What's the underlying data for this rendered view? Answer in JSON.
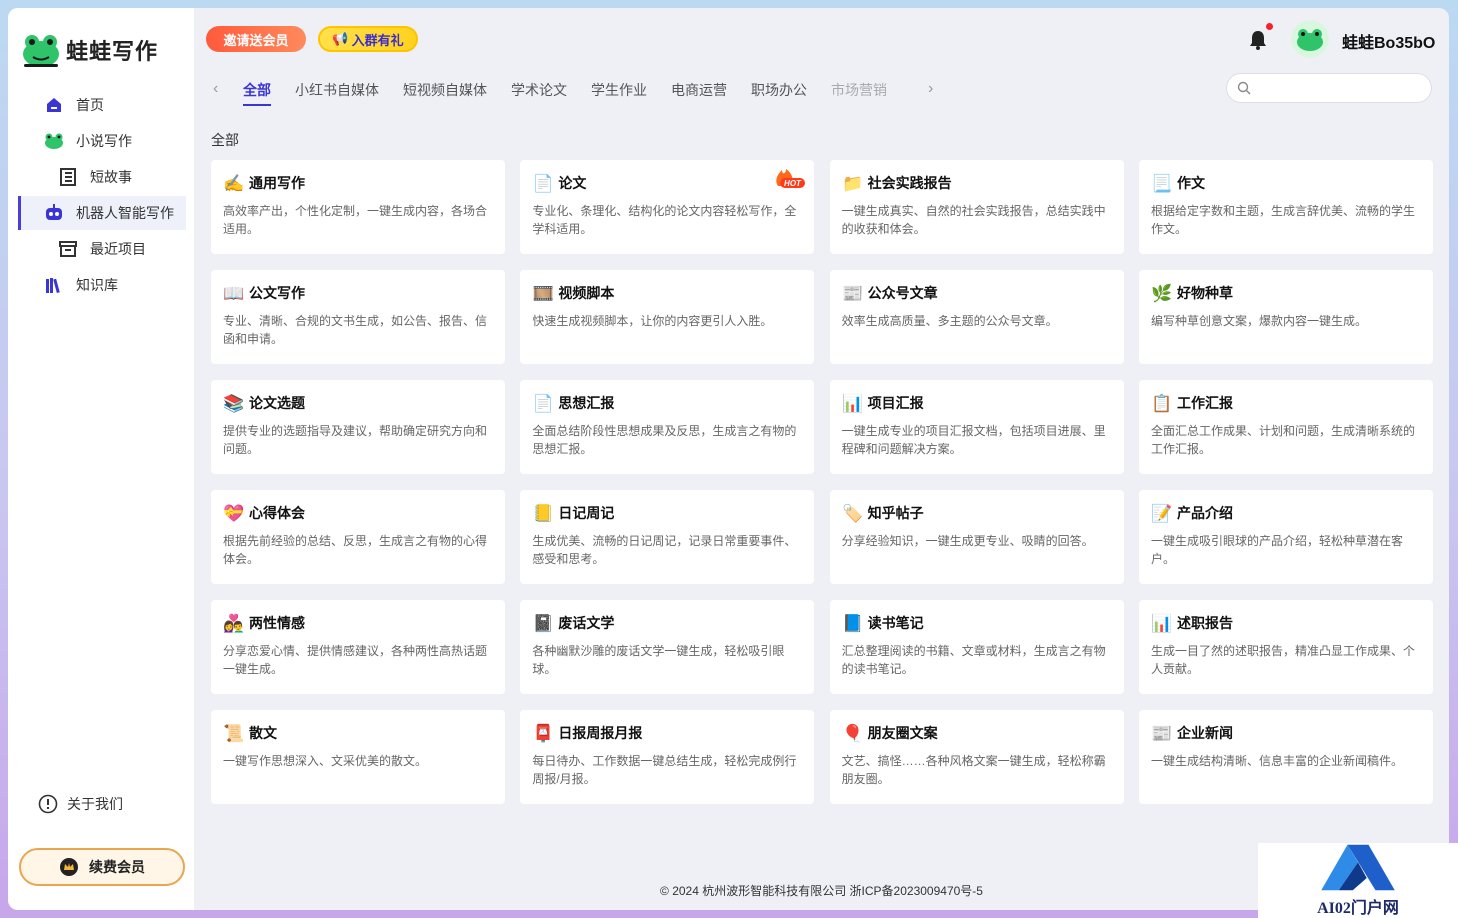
{
  "brand": {
    "name": "蛙蛙写作"
  },
  "sidebar": {
    "items": [
      {
        "label": "首页",
        "icon": "home-icon"
      },
      {
        "label": "小说写作",
        "icon": "frog-icon"
      },
      {
        "label": "短故事",
        "icon": "document-icon"
      },
      {
        "label": "机器人智能写作",
        "icon": "robot-icon"
      },
      {
        "label": "最近项目",
        "icon": "archive-icon"
      },
      {
        "label": "知识库",
        "icon": "books-icon"
      }
    ],
    "about": "关于我们",
    "renew": "续费会员"
  },
  "header": {
    "promo_invite": "邀请送会员",
    "promo_group": "入群有礼",
    "username": "蛙蛙Bo35bO"
  },
  "tabs": [
    "全部",
    "小红书自媒体",
    "短视频自媒体",
    "学术论文",
    "学生作业",
    "电商运营",
    "职场办公",
    "市场营销"
  ],
  "search": {
    "placeholder": ""
  },
  "section_title": "全部",
  "cards": [
    {
      "title": "通用写作",
      "desc": "高效率产出，个性化定制，一键生成内容，各场合适用。",
      "icon": "✍️"
    },
    {
      "title": "论文",
      "desc": "专业化、条理化、结构化的论文内容轻松写作，全学科适用。",
      "icon": "📄",
      "badge": "HOT"
    },
    {
      "title": "社会实践报告",
      "desc": "一键生成真实、自然的社会实践报告，总结实践中的收获和体会。",
      "icon": "📁"
    },
    {
      "title": "作文",
      "desc": "根据给定字数和主题，生成言辞优美、流畅的学生作文。",
      "icon": "📃"
    },
    {
      "title": "公文写作",
      "desc": "专业、清晰、合规的文书生成，如公告、报告、信函和申请。",
      "icon": "📖"
    },
    {
      "title": "视频脚本",
      "desc": "快速生成视频脚本，让你的内容更引人入胜。",
      "icon": "🎞️"
    },
    {
      "title": "公众号文章",
      "desc": "效率生成高质量、多主题的公众号文章。",
      "icon": "📰"
    },
    {
      "title": "好物种草",
      "desc": "编写种草创意文案，爆款内容一键生成。",
      "icon": "🌿"
    },
    {
      "title": "论文选题",
      "desc": "提供专业的选题指导及建议，帮助确定研究方向和问题。",
      "icon": "📚"
    },
    {
      "title": "思想汇报",
      "desc": "全面总结阶段性思想成果及反思，生成言之有物的思想汇报。",
      "icon": "📄"
    },
    {
      "title": "项目汇报",
      "desc": "一键生成专业的项目汇报文档，包括项目进展、里程碑和问题解决方案。",
      "icon": "📊"
    },
    {
      "title": "工作汇报",
      "desc": "全面汇总工作成果、计划和问题，生成清晰系统的工作汇报。",
      "icon": "📋"
    },
    {
      "title": "心得体会",
      "desc": "根据先前经验的总结、反思，生成言之有物的心得体会。",
      "icon": "💝"
    },
    {
      "title": "日记周记",
      "desc": "生成优美、流畅的日记周记，记录日常重要事件、感受和思考。",
      "icon": "📒"
    },
    {
      "title": "知乎帖子",
      "desc": "分享经验知识，一键生成更专业、吸睛的回答。",
      "icon": "🏷️"
    },
    {
      "title": "产品介绍",
      "desc": "一键生成吸引眼球的产品介绍，轻松种草潜在客户。",
      "icon": "📝"
    },
    {
      "title": "两性情感",
      "desc": "分享恋爱心情、提供情感建议，各种两性高热话题一键生成。",
      "icon": "👩‍❤️‍👨"
    },
    {
      "title": "废话文学",
      "desc": "各种幽默沙雕的废话文学一键生成，轻松吸引眼球。",
      "icon": "📓"
    },
    {
      "title": "读书笔记",
      "desc": "汇总整理阅读的书籍、文章或材料，生成言之有物的读书笔记。",
      "icon": "📘"
    },
    {
      "title": "述职报告",
      "desc": "生成一目了然的述职报告，精准凸显工作成果、个人贡献。",
      "icon": "📊"
    },
    {
      "title": "散文",
      "desc": "一键写作思想深入、文采优美的散文。",
      "icon": "📜"
    },
    {
      "title": "日报周报月报",
      "desc": "每日待办、工作数据一键总结生成，轻松完成例行周报/月报。",
      "icon": "📮"
    },
    {
      "title": "朋友圈文案",
      "desc": "文艺、搞怪……各种风格文案一键生成，轻松称霸朋友圈。",
      "icon": "🎈"
    },
    {
      "title": "企业新闻",
      "desc": "一键生成结构清晰、信息丰富的企业新闻稿件。",
      "icon": "📰"
    }
  ],
  "footer": "© 2024 杭州波形智能科技有限公司 浙ICP备2023009470号-5",
  "watermark": "AI02门户网",
  "colors": {
    "accent": "#3b35d6",
    "renew_border": "#e9a64f",
    "hot": "#ff4d1a"
  }
}
